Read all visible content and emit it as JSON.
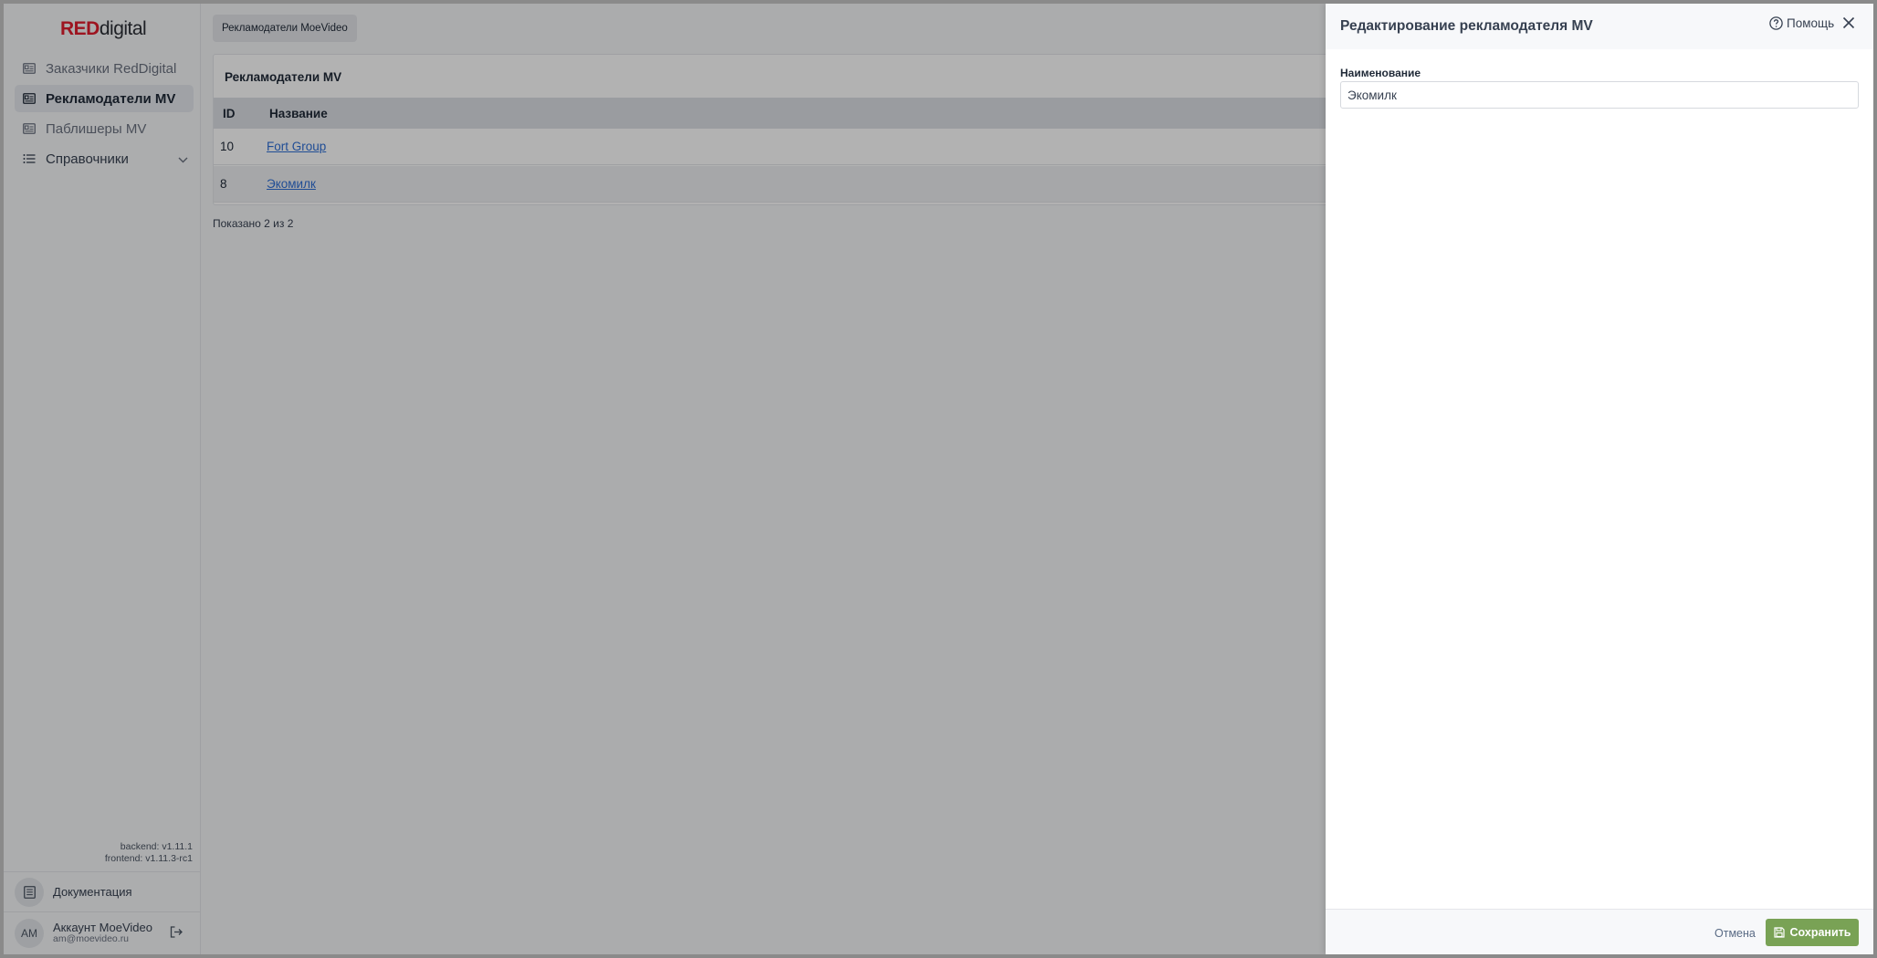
{
  "logo": {
    "red": "RED",
    "digital": "digital"
  },
  "sidebar": {
    "items": [
      {
        "label": "Заказчики RedDigital",
        "icon": "id-card-icon"
      },
      {
        "label": "Рекламодатели MV",
        "icon": "id-card-icon",
        "active": true
      },
      {
        "label": "Паблишеры MV",
        "icon": "id-card-icon"
      },
      {
        "label": "Справочники",
        "icon": "list-icon"
      }
    ],
    "versions": {
      "backend": "backend: v1.11.1",
      "frontend": "frontend: v1.11.3-rc1"
    },
    "docs_label": "Документация",
    "account": {
      "initials": "AM",
      "name": "Аккаунт MoeVideo",
      "email": "am@moevideo.ru"
    }
  },
  "main": {
    "tab_label": "Рекламодатели MoeVideo",
    "card_title": "Рекламодатели MV",
    "table": {
      "headers": [
        "ID",
        "Название"
      ],
      "rows": [
        {
          "id": "10",
          "name": "Fort Group"
        },
        {
          "id": "8",
          "name": "Экомилк"
        }
      ]
    },
    "shown_text": "Показано 2 из 2"
  },
  "drawer": {
    "title": "Редактирование рекламодателя MV",
    "help_label": "Помощь",
    "field_label": "Наименование",
    "field_value": "Экомилк",
    "cancel_label": "Отмена",
    "save_label": "Сохранить"
  },
  "colors": {
    "brand_red": "#e11d2e",
    "link": "#2f6fd6",
    "save_green": "#79a255"
  }
}
